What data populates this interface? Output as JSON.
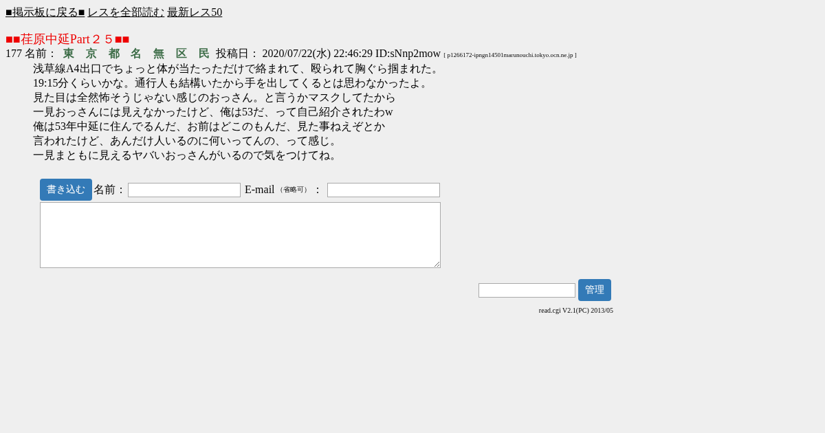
{
  "nav_links": [
    {
      "label": "■掲示板に戻る■"
    },
    {
      "label": "レスを全部読む"
    },
    {
      "label": "最新レス50"
    }
  ],
  "thread_title": "■■荏原中延Part２５■■",
  "post": {
    "number": "177",
    "name_label": "名前：",
    "name": "東京都名無区民",
    "date_label": "投稿日：",
    "date": "2020/07/22(水) 22:46:29",
    "id": "ID:sNnp2mow",
    "host": "[ p1266172-ipngn14501marunouchi.tokyo.ocn.ne.jp ]",
    "lines": [
      "浅草線A4出口でちょっと体が当たっただけで絡まれて、殴られて胸ぐら掴まれた。",
      "19:15分くらいかな。通行人も結構いたから手を出してくるとは思わなかったよ。",
      "見た目は全然怖そうじゃない感じのおっさん。と言うかマスクしてたから",
      "一見おっさんには見えなかったけど、俺は53だ、って自己紹介されたわw",
      "俺は53年中延に住んでるんだ、お前はどこのもんだ、見た事ねえぞとか",
      "言われたけど、あんだけ人いるのに何いってんの、って感じ。",
      "一見まともに見えるヤバいおっさんがいるので気をつけてね。"
    ]
  },
  "form": {
    "submit": "書き込む",
    "name_label": "名前：",
    "email_label": "E-mail",
    "email_note": "（省略可）",
    "email_colon": "："
  },
  "admin": {
    "button": "管理"
  },
  "footer": "read.cgi V2.1(PC) 2013/05"
}
